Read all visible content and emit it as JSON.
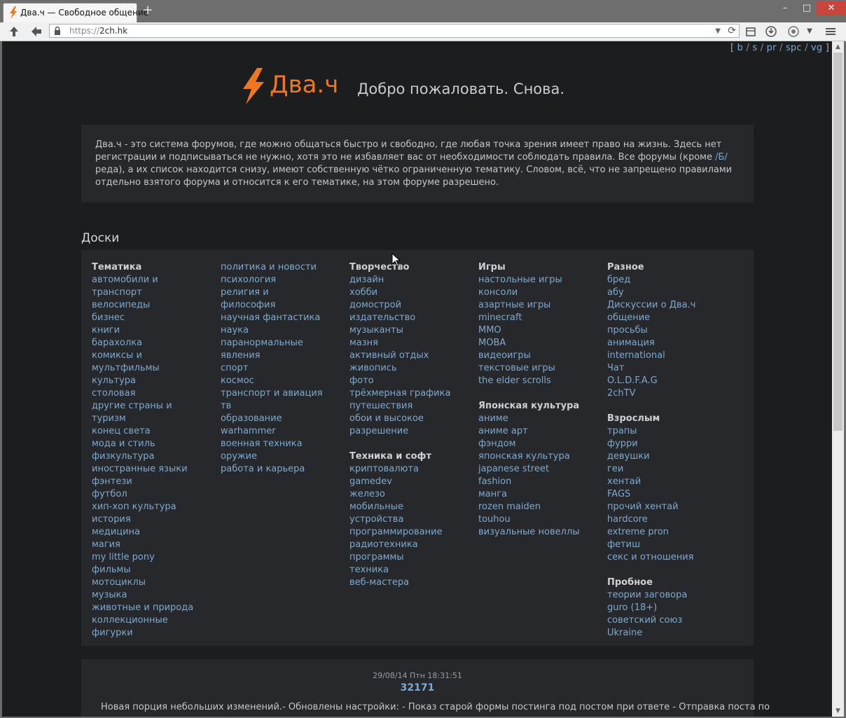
{
  "browser": {
    "tab_title": "Два.ч — Свободное общение",
    "new_tab": "+",
    "url_scheme": "https://",
    "url_host": "2ch.hk",
    "window_min": "–",
    "window_max": "□",
    "window_close": "✕"
  },
  "toplinks": {
    "open": "[",
    "close": "]",
    "sep": "/",
    "items": [
      "b",
      "s",
      "pr",
      "spc",
      "vg"
    ]
  },
  "header": {
    "logo": "Два.ч",
    "tagline": "Добро пожаловать. Снова."
  },
  "intro": {
    "text_before": "Два.ч - это система форумов, где можно общаться быстро и свободно, где любая точка зрения имеет право на жизнь. Здесь нет регистрации и подписываться не нужно, хотя это не избавляет вас от необходимости соблюдать правила. Все форумы (кроме ",
    "link": "/Б/",
    "text_after": "реда), а их список находится снизу, имеют собственную чётко ограниченную тематику. Словом, всё, что не запрещено правилами отдельно взятого форума и относится к его тематике, на этом форуме разрешено."
  },
  "boards": {
    "title": "Доски",
    "columns": [
      {
        "groups": [
          {
            "title": "Тематика",
            "items": [
              "автомобили и",
              "транспорт",
              "велосипеды",
              "бизнес",
              "книги",
              "барахолка",
              "комиксы и",
              "мультфильмы",
              "культура",
              "столовая",
              "другие страны и",
              "туризм",
              "конец света",
              "мода и стиль",
              "физкультура",
              "иностранные языки",
              "фэнтези",
              "футбол",
              "хип-хоп культура",
              "история",
              "медицина",
              "магия",
              "my little pony",
              "фильмы",
              "мотоциклы",
              "музыка",
              "животные и природа",
              "коллекционные",
              "фигурки"
            ]
          }
        ]
      },
      {
        "groups": [
          {
            "title": "",
            "items": [
              "политика и новости",
              "психология",
              "религия и",
              "философия",
              "научная фантастика",
              "наука",
              "паранормальные",
              "явления",
              "спорт",
              "космос",
              "транспорт и авиация",
              "тв",
              "образование",
              "warhammer",
              "военная техника",
              "оружие",
              "работа и карьера"
            ]
          }
        ]
      },
      {
        "groups": [
          {
            "title": "Творчество",
            "items": [
              "дизайн",
              "хобби",
              "домострой",
              "издательство",
              "музыканты",
              "мазня",
              "активный отдых",
              "живопись",
              "фото",
              "трёхмерная графика",
              "путешествия",
              "обои и высокое",
              "разрешение"
            ]
          },
          {
            "title": "Техника и софт",
            "items": [
              "криптовалюта",
              "gamedev",
              "железо",
              "мобильные",
              "устройства",
              "программирование",
              "радиотехника",
              "программы",
              "техника",
              "веб-мастера"
            ]
          }
        ]
      },
      {
        "groups": [
          {
            "title": "Игры",
            "items": [
              "настольные игры",
              "консоли",
              "азартные игры",
              "minecraft",
              "MMO",
              "MOBA",
              "видеоигры",
              "текстовые игры",
              "the elder scrolls"
            ]
          },
          {
            "title": "Японская культура",
            "items": [
              "аниме",
              "аниме арт",
              "фэндом",
              "японская культура",
              "japanese street",
              "fashion",
              "манга",
              "rozen maiden",
              "touhou",
              "визуальные новеллы"
            ]
          }
        ]
      },
      {
        "groups": [
          {
            "title": "Разное",
            "items": [
              "бред",
              "абу",
              "Дискуссии о Два.ч",
              "общение",
              "просьбы",
              "анимация",
              "international",
              "Чат",
              "O.L.D.F.A.G",
              "2chTV"
            ]
          },
          {
            "title": "Взрослым",
            "items": [
              "трапы",
              "фурри",
              "девушки",
              "геи",
              "хентай",
              "FAGS",
              "прочий хентай",
              "hardcore",
              "extreme pron",
              "фетиш",
              "секс и отношения"
            ]
          },
          {
            "title": "Пробное",
            "items": [
              "теории заговора",
              "guro (18+)",
              "советский союз",
              "Ukraine"
            ]
          }
        ]
      }
    ]
  },
  "news": {
    "date": "29/08/14 Птн 18:31:51",
    "number": "32171",
    "text": "Новая порция небольших изменений.- Обновлены настройки: - Показ старой формы постинга под постом при ответе - Отправка поста по"
  },
  "colors": {
    "page_bg": "#1c1d1f",
    "panel_bg": "#26282b",
    "link": "#7fa9cf",
    "brand": "#f07721"
  }
}
